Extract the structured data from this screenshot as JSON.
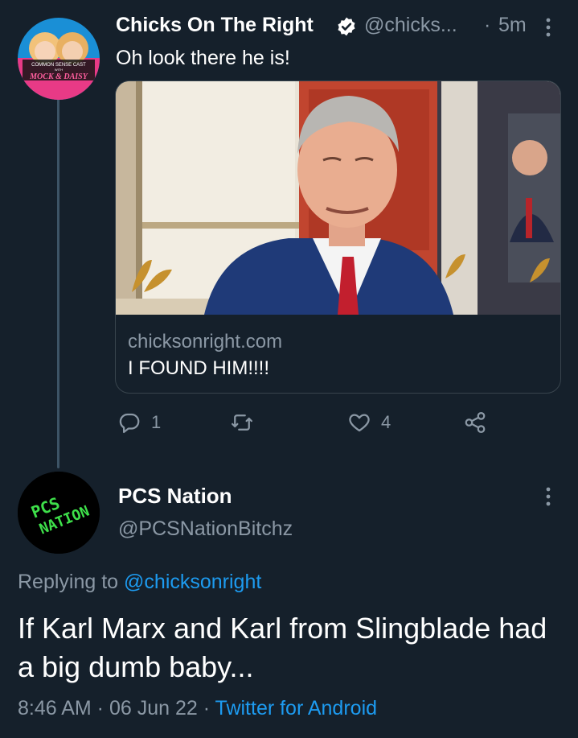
{
  "tweet1": {
    "avatar_text_top": "COMMON SENSE CAST",
    "avatar_text_with": "WITH",
    "avatar_text_bottom": "MOCK & DAISY",
    "display_name": "Chicks On The Right",
    "handle": "@chicks...",
    "separator": "·",
    "time": "5m",
    "text": "Oh look there he is!",
    "card": {
      "domain": "chicksonright.com",
      "title": "I FOUND HIM!!!!"
    },
    "actions": {
      "reply_count": "1",
      "retweet_count": "",
      "like_count": "4"
    }
  },
  "tweet2": {
    "avatar_text_line1": "PCS",
    "avatar_text_line2": "NATION",
    "display_name": "PCS Nation",
    "handle": "@PCSNationBitchz",
    "replying_prefix": "Replying to ",
    "replying_to": "@chicksonright",
    "text": "If Karl Marx and Karl from Slingblade had a big dumb baby...",
    "time": "8:46 AM",
    "sep1": " · ",
    "date": "06 Jun 22",
    "sep2": " · ",
    "source": "Twitter for Android"
  },
  "colors": {
    "background": "#15202b",
    "text": "#ffffff",
    "secondary": "#8b98a5",
    "accent": "#1d9bf0",
    "pcs_green": "#3ee04a"
  },
  "icons": {
    "verified": "verified-badge-icon",
    "more": "more-vertical-icon",
    "reply": "reply-icon",
    "retweet": "retweet-icon",
    "like": "heart-icon",
    "share": "share-icon"
  }
}
